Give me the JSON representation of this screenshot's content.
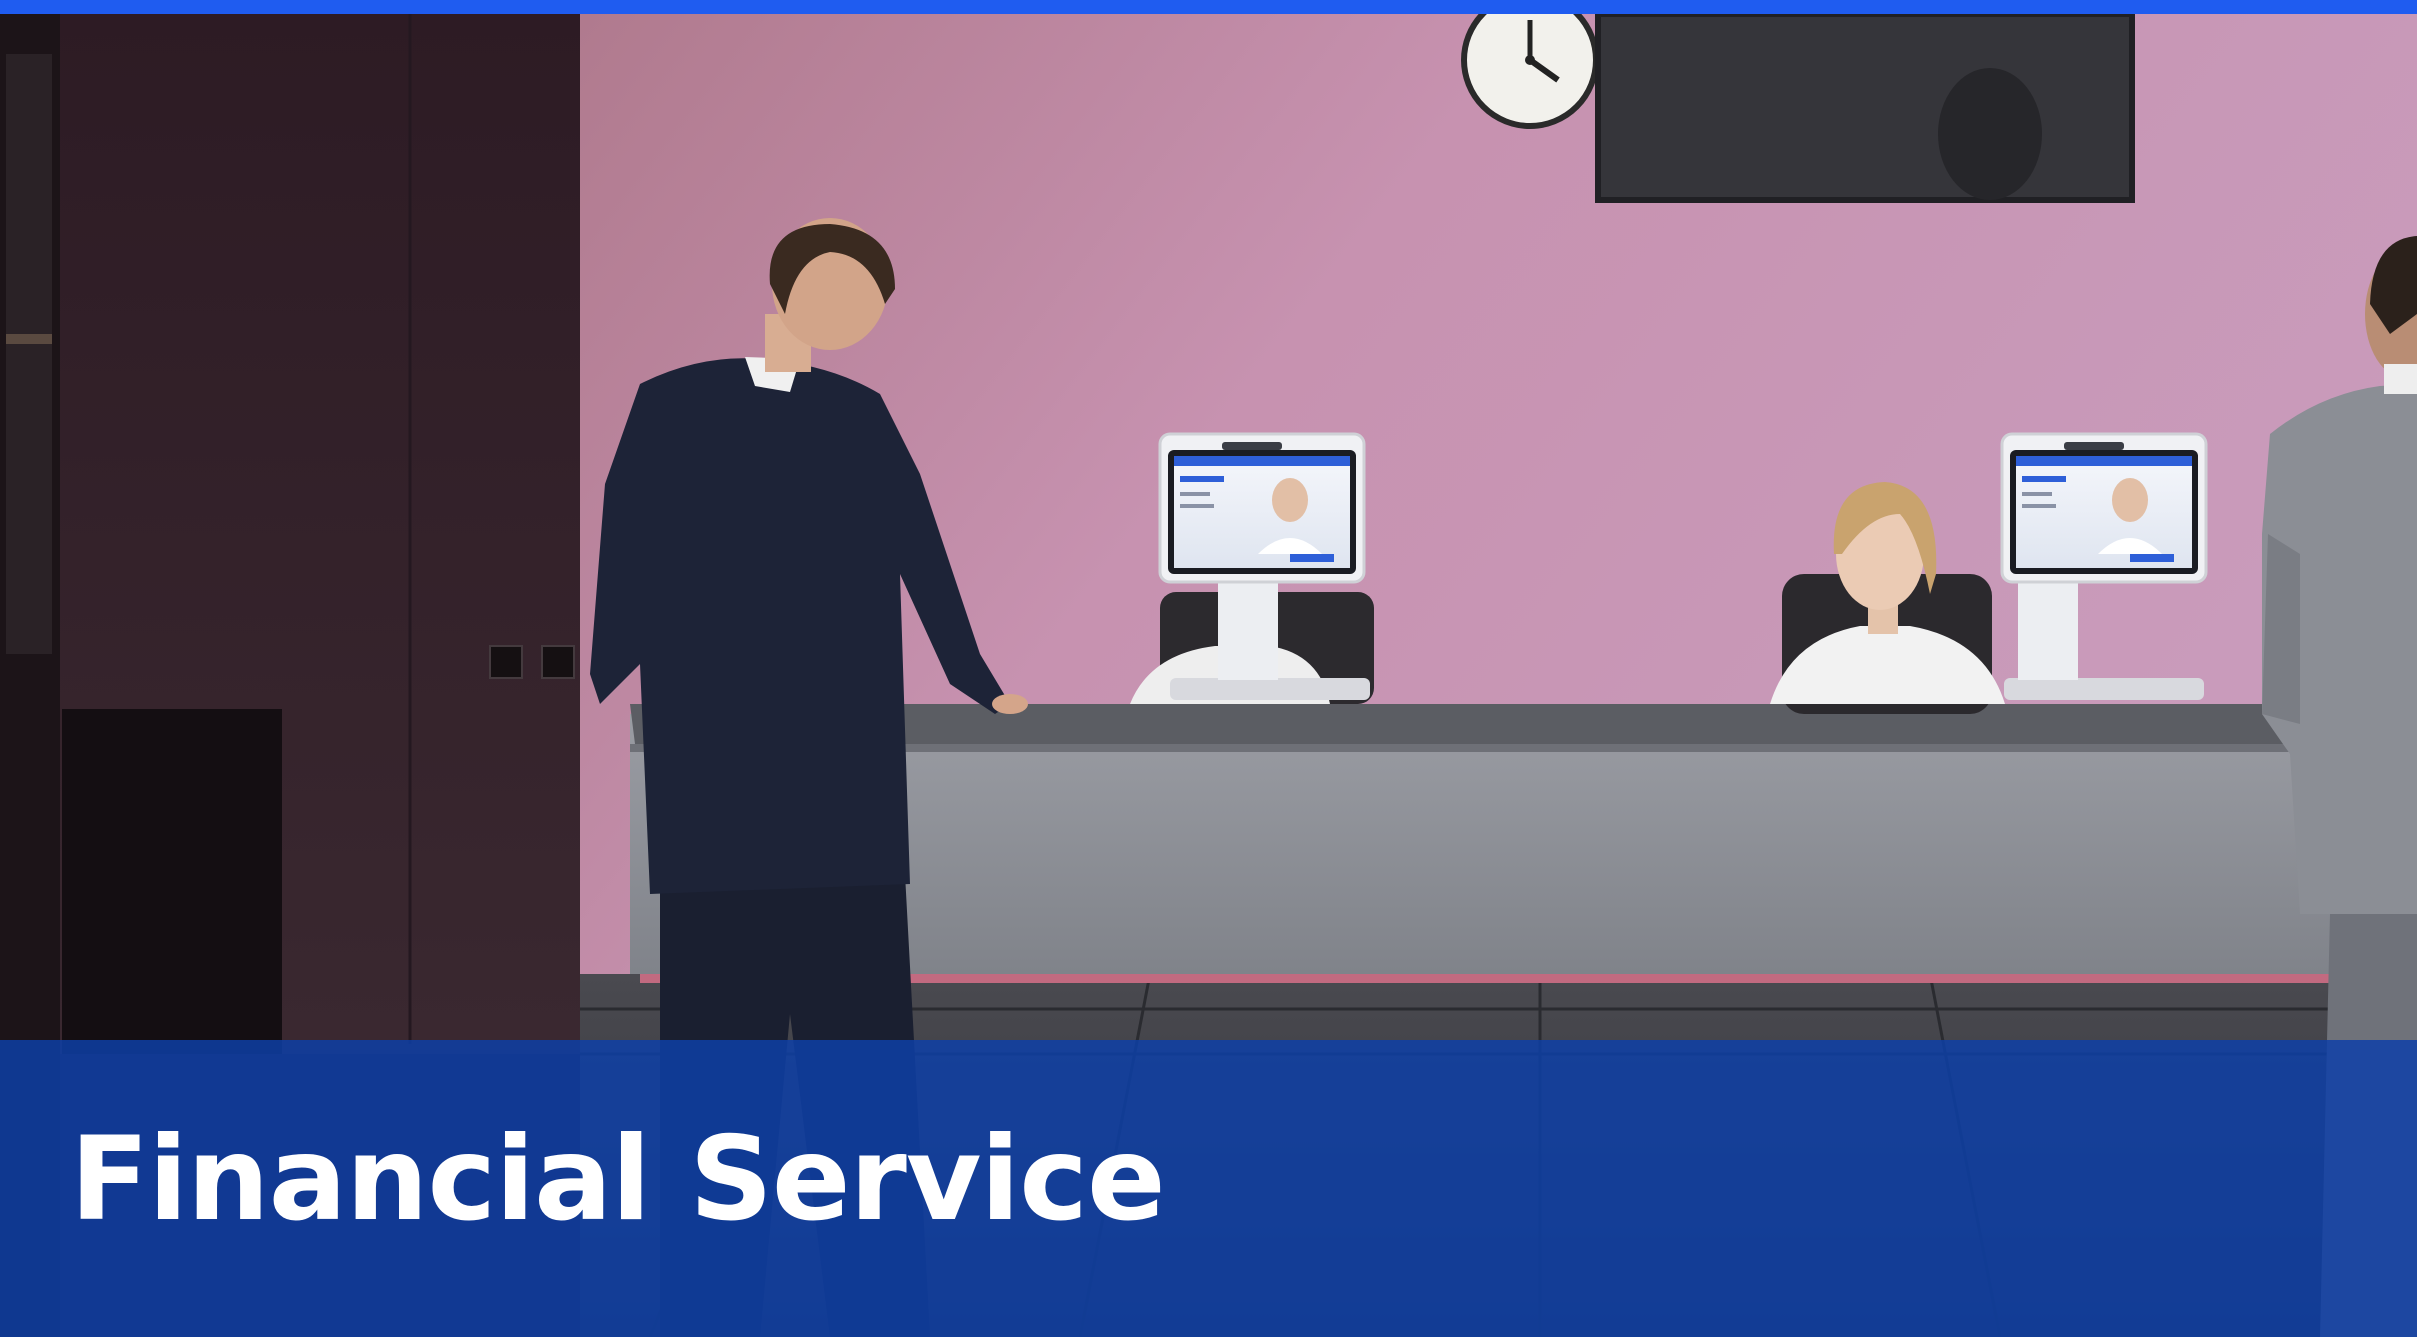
{
  "banner": {
    "title": "Financial Service"
  },
  "colors": {
    "top_bar": "#1f5cf0",
    "caption_band": "#0d3fa8",
    "wall_pink": "#c48fab",
    "counter_gray": "#8b8f96",
    "floor_dark": "#3c3d44",
    "suit_navy": "#1c2238"
  },
  "scene": {
    "description_icons": [
      "wall-clock-icon",
      "tv-screen-icon",
      "kiosk-terminal-icon"
    ]
  }
}
